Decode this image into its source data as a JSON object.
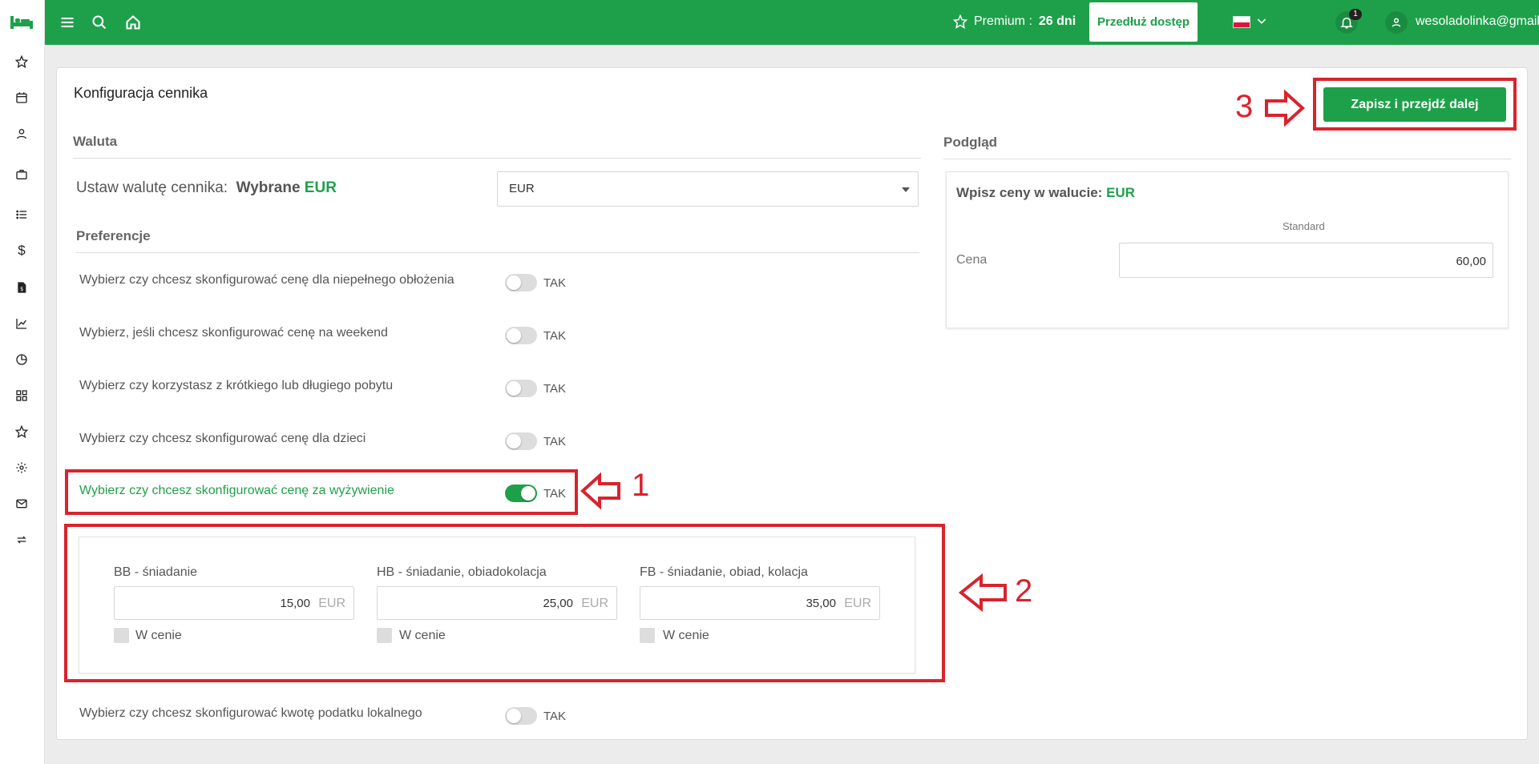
{
  "topbar": {
    "premium_label": "Premium :",
    "premium_days": "26 dni",
    "extend_button": "Przedłuż dostęp",
    "notification_count": "1",
    "user_email": "wesoladolinka@gmail.com"
  },
  "sidebar": {
    "items": [
      "star-icon",
      "calendar-icon",
      "user-icon",
      "briefcase-icon",
      "list-icon",
      "dollar-icon",
      "invoice-icon",
      "chart-icon",
      "pie-icon",
      "grid-icon",
      "star-icon",
      "gear-icon",
      "mail-icon",
      "sync-icon"
    ]
  },
  "page": {
    "title": "Konfiguracja cennika",
    "save_button": "Zapisz i przejdź dalej"
  },
  "currency": {
    "section": "Waluta",
    "label": "Ustaw walutę cennika:",
    "selected_prefix": "Wybrane",
    "selected_value": "EUR",
    "select_value": "EUR"
  },
  "preferences": {
    "section": "Preferencje",
    "toggle_label": "TAK",
    "items": [
      {
        "text": "Wybierz czy chcesz skonfigurować cenę dla niepełnego obłożenia",
        "on": false
      },
      {
        "text": "Wybierz, jeśli chcesz skonfigurować cenę na weekend",
        "on": false
      },
      {
        "text": "Wybierz czy korzystasz z krótkiego lub długiego pobytu",
        "on": false
      },
      {
        "text": "Wybierz czy chcesz skonfigurować cenę dla dzieci",
        "on": false
      },
      {
        "text": "Wybierz czy chcesz skonfigurować cenę za wyżywienie",
        "on": true
      },
      {
        "text": "Wybierz czy chcesz skonfigurować kwotę podatku lokalnego",
        "on": false
      }
    ]
  },
  "meals": {
    "currency": "EUR",
    "checkbox_label": "W cenie",
    "items": [
      {
        "label": "BB - śniadanie",
        "value": "15,00"
      },
      {
        "label": "HB - śniadanie, obiadokolacja",
        "value": "25,00"
      },
      {
        "label": "FB - śniadanie, obiad, kolacja",
        "value": "35,00"
      }
    ]
  },
  "preview": {
    "section": "Podgląd",
    "title_prefix": "Wpisz ceny w walucie:",
    "title_currency": "EUR",
    "column_header": "Standard",
    "row_label": "Cena",
    "price_value": "60,00"
  },
  "annotations": {
    "n1": "1",
    "n2": "2",
    "n3": "3",
    "color": "#d9232d"
  },
  "colors": {
    "brand_green": "#1ea04a"
  }
}
